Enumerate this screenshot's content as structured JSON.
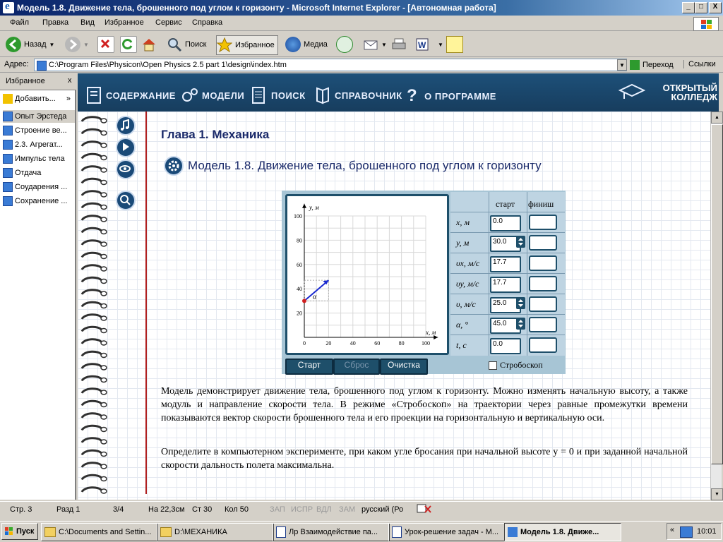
{
  "window": {
    "title": "Модель 1.8. Движение тела, брошенного под углом к горизонту - Microsoft Internet Explorer - [Автономная работа]",
    "minimize": "_",
    "maximize": "□",
    "close": "X"
  },
  "menu": [
    "Файл",
    "Правка",
    "Вид",
    "Избранное",
    "Сервис",
    "Справка"
  ],
  "toolbar": {
    "back": "Назад",
    "search": "Поиск",
    "favorites": "Избранное",
    "media": "Медиа"
  },
  "address": {
    "label": "Адрес:",
    "value": "C:\\Program Files\\Physicon\\Open Physics 2.5 part 1\\design\\index.htm",
    "go": "Переход",
    "links": "Ссылки"
  },
  "favorites": {
    "title": "Избранное",
    "add": "Добавить...",
    "items": [
      "Опыт Эрстеда",
      "Строение ве...",
      "2.3. Агрегат...",
      "Импульс тела",
      "Отдача",
      "Соударения ...",
      "Сохранение ..."
    ]
  },
  "nav": {
    "contents": "СОДЕРЖАНИЕ",
    "models": "МОДЕЛИ",
    "search": "ПОИСК",
    "reference": "СПРАВОЧНИК",
    "about": "О ПРОГРАММЕ",
    "brand_line1": "ОТКРЫТЫЙ",
    "brand_line2": "КОЛЛЕДЖ"
  },
  "page": {
    "chapter": "Глава 1. Механика",
    "model_title": "Модель 1.8.  Движение тела, брошенного под углом к горизонту",
    "paragraph1": "Модель демонстрирует движение тела, брошенного под углом к горизонту. Можно изменять начальную высоту, а также модуль и направление скорости тела. В режиме «Стробоскоп» на траектории через равные промежутки времени показываются вектор скорости брошенного тела и его проекции на горизонтальную и вертикальную оси.",
    "paragraph2": "Определите в компьютерном эксперименте, при каком угле бросания при начальной высоте y = 0 и при заданной начальной скорости дальность полета максимальна."
  },
  "model": {
    "graph": {
      "y_axis_label": "y, м",
      "x_axis_label": "x, м",
      "y_ticks": [
        "100",
        "80",
        "60",
        "40",
        "20"
      ],
      "x_ticks": [
        "0",
        "20",
        "40",
        "60",
        "80",
        "100"
      ],
      "angle_label": "α",
      "start_point": {
        "x": 0,
        "y": 30
      },
      "vector_end": {
        "x": 20,
        "y": 47
      }
    },
    "table": {
      "col_start": "старт",
      "col_finish": "финиш",
      "rows": [
        {
          "label": "x, м",
          "start": "0.0",
          "spin": false
        },
        {
          "label": "y, м",
          "start": "30.0",
          "spin": true
        },
        {
          "label": "υx, м/с",
          "start": "17.7",
          "spin": false
        },
        {
          "label": "υy, м/с",
          "start": "17.7",
          "spin": false
        },
        {
          "label": "υ, м/с",
          "start": "25.0",
          "spin": true
        },
        {
          "label": "α, °",
          "start": "45.0",
          "spin": true
        },
        {
          "label": "t, с",
          "start": "0.0",
          "spin": false
        }
      ]
    },
    "buttons": {
      "start": "Старт",
      "reset": "Сброс",
      "clear": "Очистка"
    },
    "stroboscope": "Стробоскоп"
  },
  "status": {
    "page": "Стр.  3",
    "section": "Разд  1",
    "pages": "3/4",
    "pos": "На 22,3см",
    "line": "Ст  30",
    "col": "Кол  50",
    "rec": "ЗАП",
    "trk": "ИСПР",
    "ext": "ВДЛ",
    "ovr": "ЗАМ",
    "lang": "русский (Ро"
  },
  "taskbar": {
    "start": "Пуск",
    "tasks": [
      "C:\\Documents and Settin...",
      "D:\\МЕХАНИКА",
      "Лр Взаимодействие па...",
      "Урок-решение задач - М...",
      "Модель 1.8. Движе..."
    ],
    "clock": "10:01"
  },
  "colors": {
    "title_bar": "#0a246a",
    "nav_bar": "#1d5079",
    "model_button": "#1e4f6a",
    "vector": "#1a2ad0",
    "body_point": "#d02020"
  }
}
